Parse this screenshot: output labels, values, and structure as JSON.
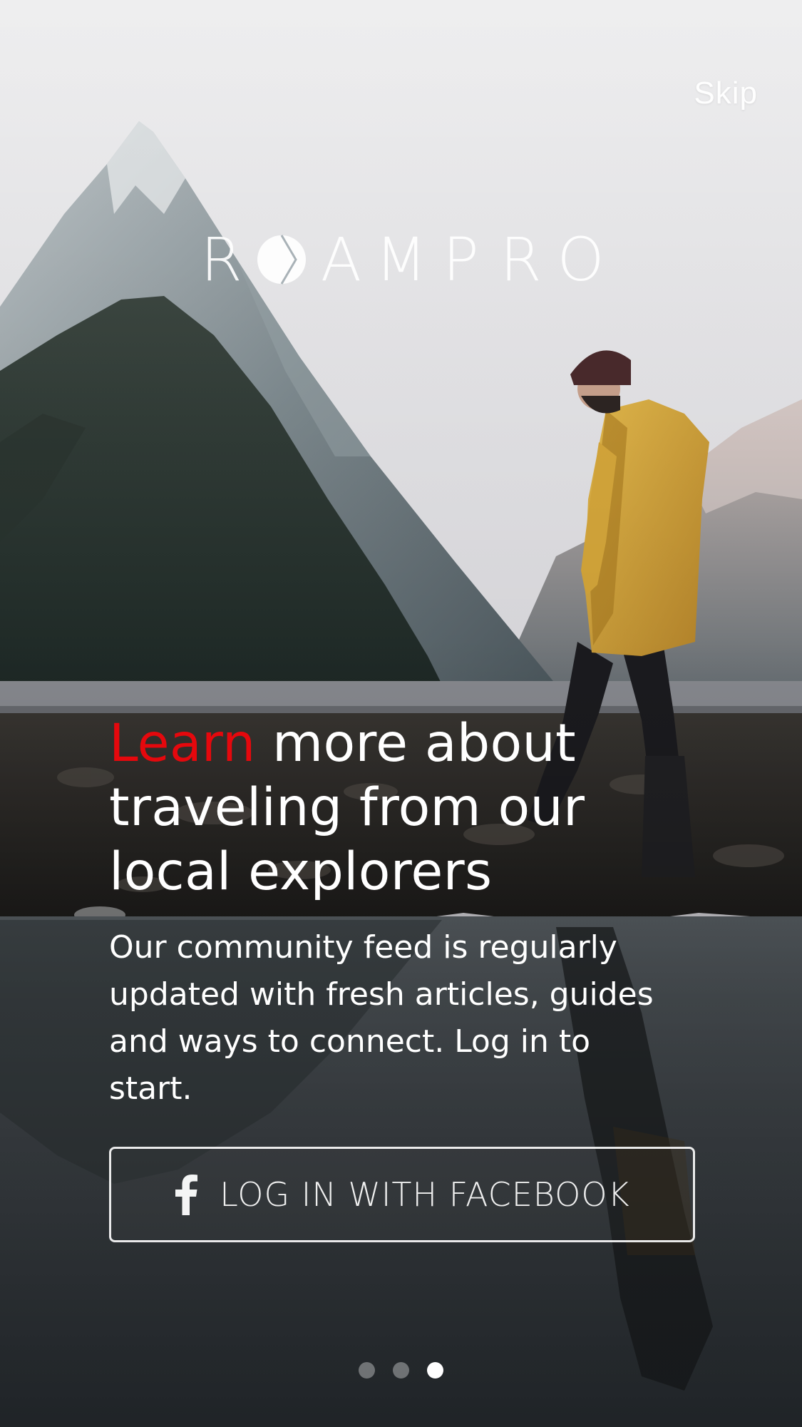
{
  "top_bar": {
    "skip_label": "Skip"
  },
  "logo": {
    "letters_before": "R",
    "letters_after": [
      "A",
      "M",
      "P",
      "R",
      "O"
    ],
    "mark_icon": "compass-circle-icon"
  },
  "headline": {
    "accent": "Learn",
    "line1_rest": "more about",
    "line2": "traveling from our",
    "line3": "local explorers"
  },
  "body_copy": "Our community feed is regularly updated with fresh articles, guides and ways to connect.  Log in to start.",
  "facebook_button": {
    "label": "LOG IN WITH FACEBOOK",
    "icon": "facebook-icon"
  },
  "pagination": {
    "total": 3,
    "current": 3
  },
  "colors": {
    "accent": "#e5080d",
    "text": "#ffffff"
  }
}
